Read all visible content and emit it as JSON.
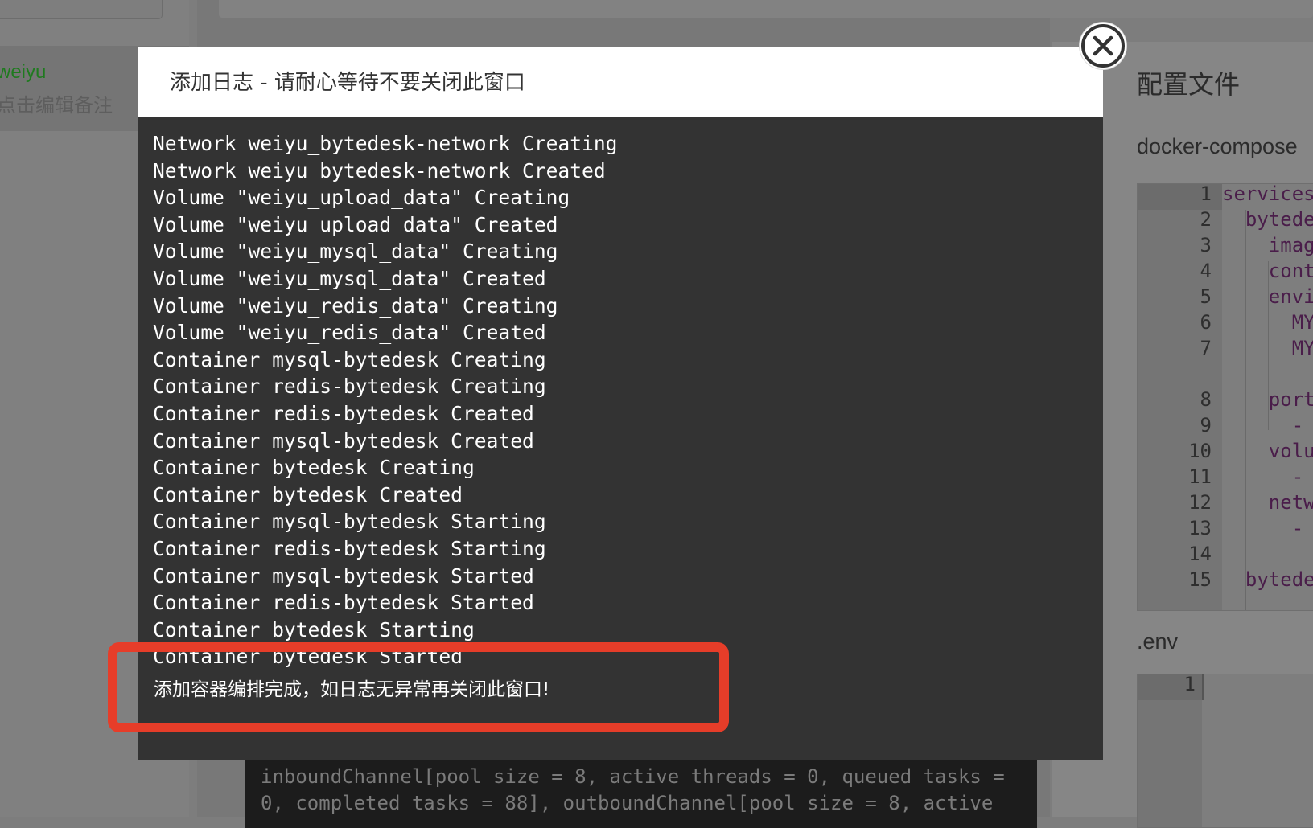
{
  "background": {
    "left_panel": {
      "item_name": "weiyu",
      "item_note": "点击编辑备注"
    },
    "config_panel": {
      "title": "配置文件",
      "file1_name": "docker-compose",
      "file1_lines": [
        {
          "n": "1",
          "code": "services"
        },
        {
          "n": "2",
          "code": "  bytede"
        },
        {
          "n": "3",
          "code": "    imag"
        },
        {
          "n": "4",
          "code": "    cont"
        },
        {
          "n": "5",
          "code": "    envi"
        },
        {
          "n": "6",
          "code": "      MY"
        },
        {
          "n": "7",
          "code": "      MY"
        },
        {
          "n": "8",
          "code": "    port"
        },
        {
          "n": "9",
          "code": "      -"
        },
        {
          "n": "10",
          "code": "    volu"
        },
        {
          "n": "11",
          "code": "      -"
        },
        {
          "n": "12",
          "code": "    netw"
        },
        {
          "n": "13",
          "code": "      -"
        },
        {
          "n": "14",
          "code": ""
        },
        {
          "n": "15",
          "code": "  bytede"
        }
      ],
      "file2_name": ".env",
      "file2_lines": [
        {
          "n": "1",
          "code": ""
        }
      ]
    },
    "console": {
      "lines": [
        "inboundChannel[pool size = 8, active threads = 0, queued tasks =",
        "0, completed tasks = 88], outboundChannel[pool size = 8, active"
      ]
    }
  },
  "modal": {
    "title": "添加日志 - 请耐心等待不要关闭此窗口",
    "close_icon": "close-circle-icon",
    "log_lines": [
      "Network weiyu_bytedesk-network Creating",
      "Network weiyu_bytedesk-network Created",
      "Volume \"weiyu_upload_data\" Creating",
      "Volume \"weiyu_upload_data\" Created",
      "Volume \"weiyu_mysql_data\" Creating",
      "Volume \"weiyu_mysql_data\" Created",
      "Volume \"weiyu_redis_data\" Creating",
      "Volume \"weiyu_redis_data\" Created",
      "Container mysql-bytedesk Creating",
      "Container redis-bytedesk Creating",
      "Container redis-bytedesk Created",
      "Container mysql-bytedesk Created",
      "Container bytedesk Creating",
      "Container bytedesk Created",
      "Container mysql-bytedesk Starting",
      "Container redis-bytedesk Starting",
      "Container mysql-bytedesk Started",
      "Container redis-bytedesk Started",
      "Container bytedesk Starting",
      "Container bytedesk Started"
    ],
    "completion_message": "添加容器编排完成，如日志无异常再关闭此窗口!"
  },
  "colors": {
    "overlay": "#7d7d7d",
    "modal_body": "#333333",
    "highlight": "#e63d29",
    "accent_green": "#1f7a1f"
  }
}
